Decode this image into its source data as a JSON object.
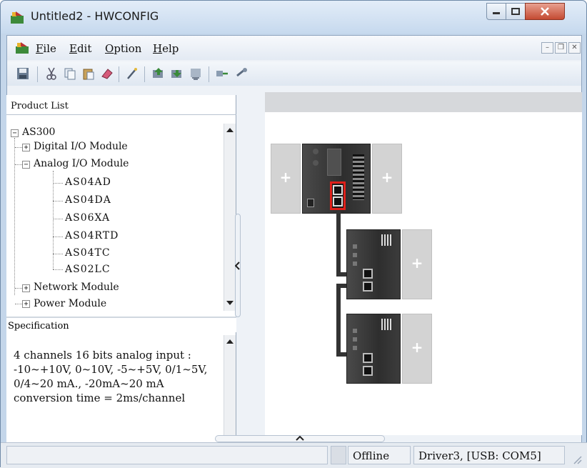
{
  "window": {
    "title": "Untitled2 - HWCONFIG",
    "minimize_icon": "minimize-icon",
    "maximize_icon": "maximize-icon",
    "close_icon": "close-icon"
  },
  "menubar": {
    "file": "File",
    "edit": "Edit",
    "option": "Option",
    "help": "Help"
  },
  "toolbar": {
    "icons": [
      "save-icon",
      "cut-icon",
      "copy-icon",
      "paste-icon",
      "erase-icon",
      "wand-icon",
      "upload-icon",
      "download-icon",
      "scan-icon",
      "transfer-icon",
      "link-icon"
    ]
  },
  "product_list": {
    "header": "Product List",
    "root": "AS300",
    "groups": [
      {
        "label": "Digital I/O Module",
        "expanded": false
      },
      {
        "label": "Analog I/O Module",
        "expanded": true,
        "items": [
          "AS04AD",
          "AS04DA",
          "AS06XA",
          "AS04RTD",
          "AS04TC",
          "AS02LC"
        ]
      },
      {
        "label": "Network Module",
        "expanded": false
      },
      {
        "label": "Power Module",
        "expanded": false
      }
    ]
  },
  "specification": {
    "header": "Specification",
    "text": "4 channels 16 bits analog input : -10~+10V, 0~10V, -5~+5V, 0/1~5V, 0/4~20 mA., -20mA~20 mA conversion time = 2ms/channel"
  },
  "canvas": {
    "slot_label": "+"
  },
  "status": {
    "mode": "Offline",
    "driver": "Driver3, [USB: COM5]"
  },
  "colors": {
    "title_bg": "#c6d9ee",
    "close_red": "#c44a32",
    "highlight": "#e0201a",
    "module_dark": "#2e2e2e"
  }
}
